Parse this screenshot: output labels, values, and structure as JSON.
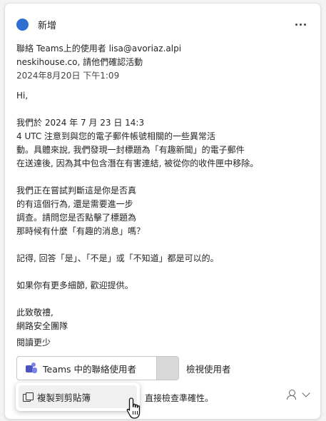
{
  "header": {
    "title": "新增",
    "more_icon": "more-horizontal-icon",
    "dot_color": "#2f6fd1"
  },
  "meta": {
    "line1": "聯絡 Teams上的使用者  lisa@avoriaz.alpi",
    "line2": "neskihouse.co, 請他們確認活動",
    "date": "2024年8月20日 下午1:09"
  },
  "body": {
    "greeting": "Hi,",
    "paragraphs": [
      "我們於 2024 年 7 月 23 日 14:3\n4 UTC 注意到與您的電子郵件帳號相關的一些異常活\n動。具體來說, 我們發現一封標題為「有趣新聞」的電子郵件\n在送達後, 因為其中包含潛在有害連結, 被從你的收件匣中移除。",
      "我們正在嘗試判斷這是你是否真\n的有這個行為, 還是需要進一步\n調查。請問您是否點擊了標題為\n那時候有什麼「有趣的消息」嗎？",
      "記得, 回答「是」、「不是」或「不知道」都是可以的。",
      "如果你有更多細節, 歡迎提供。",
      "此致敬禮,\n網路安全團隊"
    ]
  },
  "read_less": "閱讀更少",
  "teams_button": {
    "label": "Teams 中的聯絡使用者",
    "icon": "teams-icon"
  },
  "view_user": "檢視使用者",
  "footer_text": "直接檢查準確性。",
  "context_menu": {
    "item_label": "複製到剪貼簿",
    "icon": "copy-icon"
  }
}
